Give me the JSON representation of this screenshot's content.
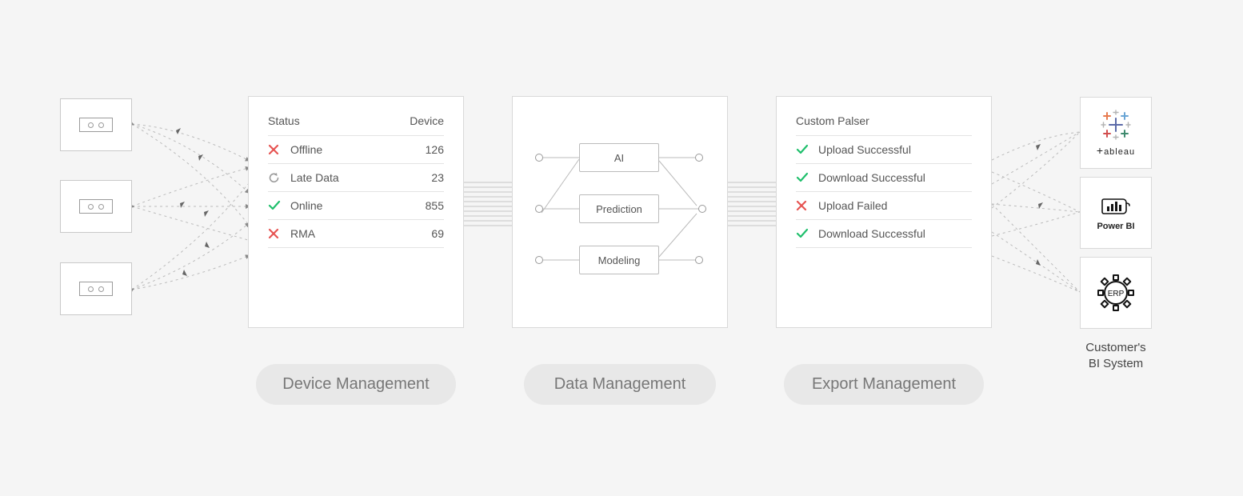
{
  "device_management": {
    "headers": {
      "status": "Status",
      "device": "Device"
    },
    "rows": [
      {
        "status": "error",
        "label": "Offline",
        "value": "126"
      },
      {
        "status": "retry",
        "label": "Late Data",
        "value": "23"
      },
      {
        "status": "ok",
        "label": "Online",
        "value": "855"
      },
      {
        "status": "error",
        "label": "RMA",
        "value": "69"
      }
    ],
    "pill": "Device Management"
  },
  "data_management": {
    "nodes": {
      "ai": "AI",
      "prediction": "Prediction",
      "modeling": "Modeling"
    },
    "pill": "Data Management"
  },
  "export_management": {
    "title": "Custom Palser",
    "rows": [
      {
        "status": "ok",
        "label": "Upload Successful"
      },
      {
        "status": "ok",
        "label": "Download Successful"
      },
      {
        "status": "error",
        "label": "Upload Failed"
      },
      {
        "status": "ok",
        "label": "Download Successful"
      }
    ],
    "pill": "Export Management"
  },
  "bi_targets": {
    "tableau": "ableau",
    "powerbi": "Power BI",
    "erp": "ERP",
    "caption_line1": "Customer's",
    "caption_line2": "BI System"
  },
  "colors": {
    "ok": "#1fbf6c",
    "error": "#e65452",
    "neutral": "#9a9a9a"
  }
}
